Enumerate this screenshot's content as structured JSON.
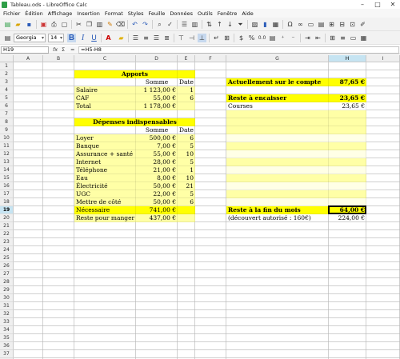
{
  "window": {
    "title": "Tableau.ods - LibreOffice Calc"
  },
  "menu": [
    "Fichier",
    "Édition",
    "Affichage",
    "Insertion",
    "Format",
    "Styles",
    "Feuille",
    "Données",
    "Outils",
    "Fenêtre",
    "Aide"
  ],
  "toolbar": {
    "font_name": "Georgia",
    "font_size": "14",
    "bold": "B",
    "italic": "I",
    "underline": "U",
    "currency": "$",
    "percent": "%",
    "number_format": "0.0"
  },
  "formula_bar": {
    "cell_ref": "H19",
    "fx": "fx",
    "sum": "Σ",
    "equals": "=",
    "formula": "=H5-H8"
  },
  "columns": [
    "A",
    "B",
    "C",
    "D",
    "E",
    "F",
    "G",
    "H",
    "I"
  ],
  "selected_column": "H",
  "rows": [
    "1",
    "2",
    "3",
    "4",
    "5",
    "6",
    "7",
    "8",
    "9",
    "10",
    "11",
    "12",
    "13",
    "14",
    "15",
    "16",
    "17",
    "18",
    "19",
    "20",
    "21",
    "22",
    "23",
    "24",
    "25",
    "26",
    "27",
    "28",
    "29",
    "30",
    "31",
    "32",
    "33",
    "34",
    "35",
    "36",
    "37",
    "38",
    "39"
  ],
  "selected_row": "19",
  "colors": {
    "yellow": "#ffff00",
    "light_yellow": "#ffffa6",
    "selection": "#c6e4f2"
  },
  "sheet": {
    "apports_header": "Apports",
    "somme_header": "Somme",
    "date_header": "Date",
    "apports": [
      {
        "label": "Salaire",
        "amount": "1 123,00 €",
        "date": "1"
      },
      {
        "label": "CAF",
        "amount": "55,00 €",
        "date": "6"
      },
      {
        "label": "Total",
        "amount": "1 178,00 €",
        "date": ""
      }
    ],
    "depenses_header": "Dépenses indispensables",
    "depenses_somme": "Somme",
    "depenses_date": "Date",
    "depenses": [
      {
        "label": "Loyer",
        "amount": "500,00 €",
        "date": "6"
      },
      {
        "label": "Banque",
        "amount": "7,00 €",
        "date": "5"
      },
      {
        "label": "Assurance + santé",
        "amount": "55,00 €",
        "date": "10"
      },
      {
        "label": "Internet",
        "amount": "28,00 €",
        "date": "5"
      },
      {
        "label": "Téléphone",
        "amount": "21,00 €",
        "date": "1"
      },
      {
        "label": "Eau",
        "amount": "8,00 €",
        "date": "10"
      },
      {
        "label": "Électricité",
        "amount": "50,00 €",
        "date": "21"
      },
      {
        "label": "UGC",
        "amount": "22,00 €",
        "date": "5"
      },
      {
        "label": "Mettre de côté",
        "amount": "50,00 €",
        "date": "6"
      },
      {
        "label": "Nécessaire",
        "amount": "741,00 €",
        "date": ""
      },
      {
        "label": "Reste pour manger",
        "amount": "437,00 €",
        "date": ""
      }
    ],
    "actuellement_label": "Actuellement sur le compte",
    "actuellement_value": "87,65 €",
    "reste_label": "Reste à encaisser",
    "reste_value": "23,65 €",
    "courses_label": "Courses",
    "courses_value": "23,65 €",
    "fin_label": "Reste à la fin du mois",
    "fin_value": "64,00 €",
    "decouvert_label": "(découvert autorisé : 160€)",
    "decouvert_value": "224,00 €"
  }
}
